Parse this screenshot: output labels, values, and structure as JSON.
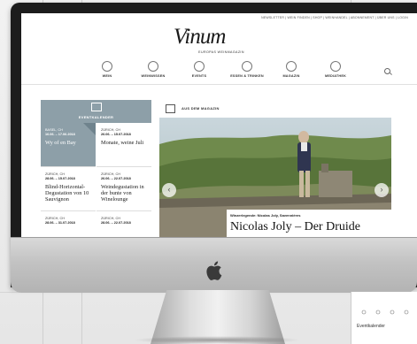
{
  "site": {
    "top_links": "NEWSLETTER | WEIN FINDEN | SHOP | WEINHANDEL | ABONNEMENT | ÜBER UNS | LOGIN",
    "logo": "Vinum",
    "logo_sub": "EUROPAS WEINMAGAZIN"
  },
  "menu": [
    {
      "label": "WEIN",
      "icon": "wine-icon"
    },
    {
      "label": "WEINWISSEN",
      "icon": "grapes-icon"
    },
    {
      "label": "EVENTS",
      "icon": "calendar-icon"
    },
    {
      "label": "ESSEN & TRINKEN",
      "icon": "cutlery-icon"
    },
    {
      "label": "MAGAZIN",
      "icon": "magazine-icon"
    },
    {
      "label": "MEDIATHEK",
      "icon": "star-icon"
    }
  ],
  "calendar": {
    "title": "EVENTKALENDER",
    "events": [
      {
        "place": "BASEL, CH",
        "date": "16.06. – 17.06.2018",
        "name": "Wy of en Bay"
      },
      {
        "place": "ZÜRICH, CH",
        "date": "26.06. – 15.07.2018",
        "name": "Monate, weine Juli"
      },
      {
        "place": "ZÜRICH, CH",
        "date": "28.06. – 15.07.2018",
        "name": "Blind-Horizontal-Degustation von 10 Sauvignon"
      },
      {
        "place": "ZÜRICH, CH",
        "date": "26.06. – 22.07.2018",
        "name": "Weindegustation in der bunte von Winelounge"
      },
      {
        "place": "ZÜRICH, CH",
        "date": "28.06. – 31.07.2018",
        "name": ""
      },
      {
        "place": "ZÜRICH, CH",
        "date": "28.06. – 22.07.2018",
        "name": ""
      }
    ]
  },
  "magazine": {
    "title": "AUS DEM MAGAZIN",
    "kicker": "Winzerlegende: Nicolas Joly, Savennières",
    "headline": "Nicolas Joly – Der Druide"
  },
  "peek": {
    "label": "Eventkalender"
  },
  "colors": {
    "accent": "#8d9fa8",
    "bezel": "#1c1c1c"
  }
}
